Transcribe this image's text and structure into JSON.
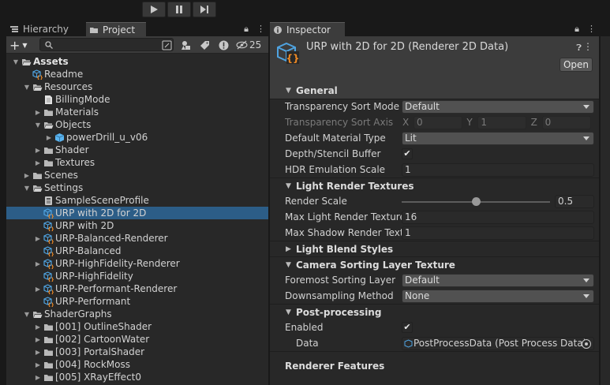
{
  "toolbar": {
    "play_icon": "play-icon",
    "pause_icon": "pause-icon",
    "step_icon": "step-icon"
  },
  "project": {
    "tabs": [
      {
        "label": "Hierarchy",
        "icon": "hierarchy-icon"
      },
      {
        "label": "Project",
        "icon": "folder-icon"
      }
    ],
    "search_value": "",
    "hidden_count": "25",
    "tree": [
      {
        "label": "Assets",
        "depth": 0,
        "icon": "folder-open",
        "fold": "open",
        "bold": true
      },
      {
        "label": "Readme",
        "depth": 1,
        "icon": "asset",
        "fold": "none"
      },
      {
        "label": "Resources",
        "depth": 1,
        "icon": "folder-open",
        "fold": "open"
      },
      {
        "label": "BillingMode",
        "depth": 2,
        "icon": "file",
        "fold": "none"
      },
      {
        "label": "Materials",
        "depth": 2,
        "icon": "folder",
        "fold": "closed"
      },
      {
        "label": "Objects",
        "depth": 2,
        "icon": "folder-open",
        "fold": "open"
      },
      {
        "label": "powerDrill_u_v06",
        "depth": 3,
        "icon": "prefab",
        "fold": "closed"
      },
      {
        "label": "Shader",
        "depth": 2,
        "icon": "folder",
        "fold": "closed"
      },
      {
        "label": "Textures",
        "depth": 2,
        "icon": "folder",
        "fold": "closed"
      },
      {
        "label": "Scenes",
        "depth": 1,
        "icon": "folder",
        "fold": "closed"
      },
      {
        "label": "Settings",
        "depth": 1,
        "icon": "folder-open",
        "fold": "open"
      },
      {
        "label": "SampleSceneProfile",
        "depth": 2,
        "icon": "profile",
        "fold": "none"
      },
      {
        "label": "URP with 2D for 2D",
        "depth": 2,
        "icon": "asset",
        "fold": "none",
        "selected": true
      },
      {
        "label": "URP with 2D",
        "depth": 2,
        "icon": "asset",
        "fold": "none"
      },
      {
        "label": "URP-Balanced-Renderer",
        "depth": 2,
        "icon": "asset",
        "fold": "closed"
      },
      {
        "label": "URP-Balanced",
        "depth": 2,
        "icon": "asset",
        "fold": "none"
      },
      {
        "label": "URP-HighFidelity-Renderer",
        "depth": 2,
        "icon": "asset",
        "fold": "closed"
      },
      {
        "label": "URP-HighFidelity",
        "depth": 2,
        "icon": "asset",
        "fold": "none"
      },
      {
        "label": "URP-Performant-Renderer",
        "depth": 2,
        "icon": "asset",
        "fold": "closed"
      },
      {
        "label": "URP-Performant",
        "depth": 2,
        "icon": "asset",
        "fold": "none"
      },
      {
        "label": "ShaderGraphs",
        "depth": 1,
        "icon": "folder-open",
        "fold": "open"
      },
      {
        "label": "[001] OutlineShader",
        "depth": 2,
        "icon": "folder",
        "fold": "closed"
      },
      {
        "label": "[002] CartoonWater",
        "depth": 2,
        "icon": "folder",
        "fold": "closed"
      },
      {
        "label": "[003] PortalShader",
        "depth": 2,
        "icon": "folder",
        "fold": "closed"
      },
      {
        "label": "[004] RockMoss",
        "depth": 2,
        "icon": "folder",
        "fold": "closed"
      },
      {
        "label": "[005] XRayEffect0",
        "depth": 2,
        "icon": "folder",
        "fold": "closed"
      }
    ]
  },
  "inspector": {
    "tab_label": "Inspector",
    "title": "URP with 2D for 2D (Renderer 2D Data)",
    "open_label": "Open",
    "sections": {
      "general": "General",
      "light_render": "Light Render Textures",
      "light_blend": "Light Blend Styles",
      "camera_sorting": "Camera Sorting Layer Texture",
      "post": "Post-processing",
      "features": "Renderer Features"
    },
    "props": {
      "transparency_sort_mode": {
        "label": "Transparency Sort Mode",
        "value": "Default"
      },
      "transparency_sort_axis": {
        "label": "Transparency Sort Axis",
        "x_label": "X",
        "x": "0",
        "y_label": "Y",
        "y": "1",
        "z_label": "Z",
        "z": "0"
      },
      "default_material_type": {
        "label": "Default Material Type",
        "value": "Lit"
      },
      "depth_stencil": {
        "label": "Depth/Stencil Buffer",
        "checked": true
      },
      "hdr_scale": {
        "label": "HDR Emulation Scale",
        "value": "1"
      },
      "render_scale": {
        "label": "Render Scale",
        "value": "0.5",
        "fraction": 0.5
      },
      "max_light_textures": {
        "label": "Max Light Render Textures",
        "value": "16"
      },
      "max_shadow_textures": {
        "label": "Max Shadow Render Textures",
        "value": "1"
      },
      "foremost_sorting": {
        "label": "Foremost Sorting Layer",
        "value": "Default"
      },
      "downsampling": {
        "label": "Downsampling Method",
        "value": "None"
      },
      "pp_enabled": {
        "label": "Enabled",
        "checked": true
      },
      "pp_data": {
        "label": "Data",
        "value": "PostProcessData (Post Process Data)"
      }
    }
  },
  "colors": {
    "selection": "#2c5d87",
    "panel": "#282828",
    "folder": "#b9b9b9",
    "asset_blue": "#4fa3e0",
    "asset_orange": "#f08a24"
  }
}
